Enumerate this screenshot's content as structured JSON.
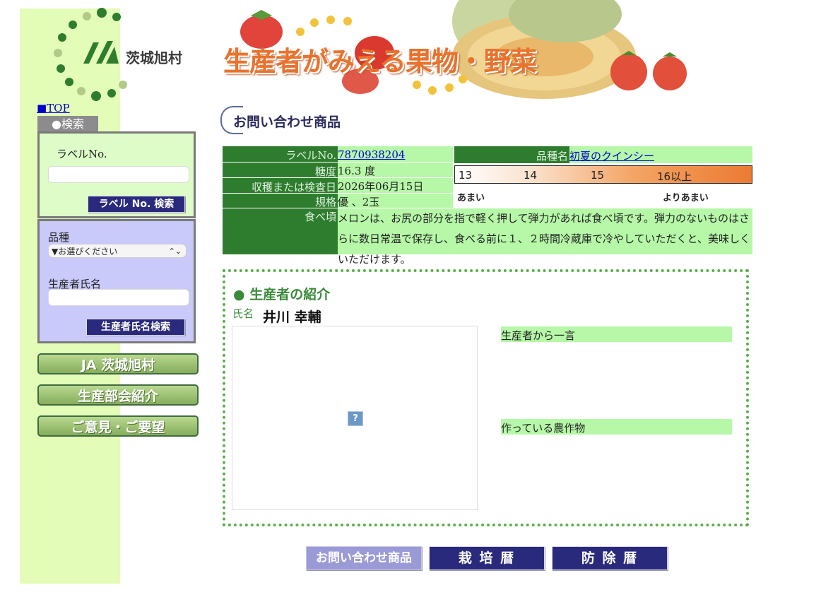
{
  "brand": {
    "name": "茨城旭村",
    "logo_letters": "JA"
  },
  "banner": {
    "title": "生産者がみえる果物・野菜"
  },
  "sidebar": {
    "top_link": "■TOP",
    "search_tab": "●検索",
    "label_no": {
      "label": "ラベルNo.",
      "value": "",
      "button": "ラベル No. 検索"
    },
    "variety": {
      "label": "品種",
      "selected": "▼お選びください"
    },
    "producer": {
      "label": "生産者氏名",
      "value": "",
      "button": "生産者氏名検索"
    },
    "nav": [
      "JA 茨城旭村",
      "生産部会紹介",
      "ご意見・ご要望"
    ]
  },
  "section_title": "お問い合わせ商品",
  "product": {
    "label_no_label": "ラベルNo.",
    "label_no": "7870938204",
    "sugar_label": "糖度",
    "sugar": "16.3 度",
    "harvest_label": "収穫または検査日",
    "harvest": "2026年06月15日",
    "grade_label": "規格",
    "grade": "優 、2玉",
    "eat_label": "食べ頃",
    "eat": "メロンは、お尻の部分を指で軽く押して弾力があれば食べ頃です。弾力のないものはさらに数日常温で保存し、食べる前に１、２時間冷蔵庫で冷やしていただくと、美味しくいただけます。",
    "variety_label": "品種名",
    "variety": "初夏のクインシー"
  },
  "sugar_scale": {
    "ticks": [
      "13",
      "14",
      "15",
      "16以上"
    ],
    "low": "あまい",
    "high": "よりあまい"
  },
  "producer_section": {
    "heading": "● 生産者の紹介",
    "name_label": "氏名",
    "name": "井川 幸輔",
    "photo_placeholder": "?",
    "message_label": "生産者から一言",
    "crops_label": "作っている農作物"
  },
  "bottom_buttons": [
    "お問い合わせ商品",
    "栽 培 暦",
    "防 除 暦"
  ],
  "colors": {
    "sidebar_bg": "#e3fcb7",
    "label_bg": "#2e7d2e",
    "value_bg": "#b6f8a8",
    "navy": "#2a2a7d",
    "accent_orange": "#e9722c"
  }
}
